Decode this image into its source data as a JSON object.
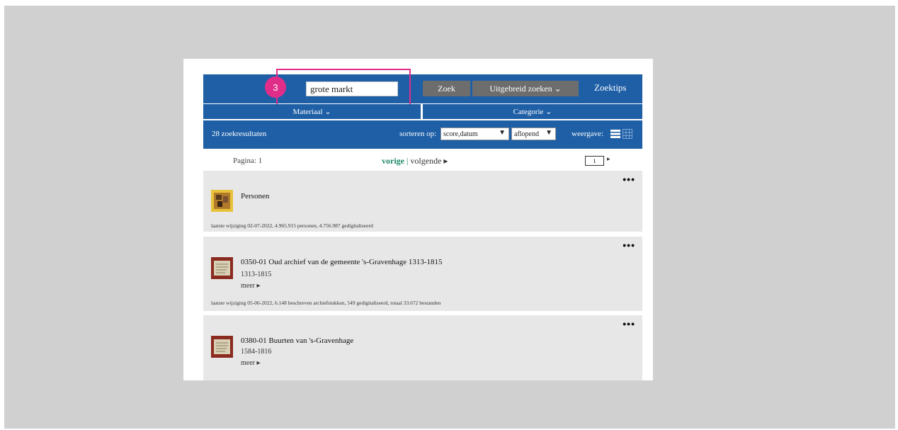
{
  "search": {
    "value": "grote markt",
    "zoek_label": "Zoek",
    "uitgebreid_label": "Uitgebreid zoeken ⌄",
    "zoektips_label": "Zoektips",
    "step_badge": "3",
    "highlight_color": "#e12d8a"
  },
  "filters": {
    "materiaal": "Materiaal ⌄",
    "categorie": "Categorie ⌄"
  },
  "results": {
    "count_label": "28 zoekresultaten",
    "sort_label": "sorteren op:",
    "sort_field": "score,datum",
    "sort_order": "aflopend",
    "view_label": "weergave:"
  },
  "pagination": {
    "pagina_label": "Pagina: 1",
    "prev_label": "vorige",
    "separator": "|",
    "next_label": "volgende ▸",
    "page_input": "1",
    "arrow": "▸"
  },
  "cards": [
    {
      "title": "Personen",
      "meta": "laatste wijziging 02-07-2022, 4.965.915 personen, 4.756.987 gedigitaliseerd",
      "more": "•••"
    },
    {
      "title": "0350-01 Oud archief van de gemeente 's-Gravenhage 1313-1815",
      "sub": "1313-1815",
      "meer": "meer ▸",
      "meta": "laatste wijziging 05-06-2022, 6.148 beschreven archiefstukken, 549 gedigitaliseerd, totaal 33.672 bestanden",
      "more": "•••"
    },
    {
      "title": "0380-01 Buurten van 's-Gravenhage",
      "sub": "1584-1816",
      "meer": "meer ▸",
      "more": "•••"
    }
  ],
  "colors": {
    "brand_blue": "#1e5fa6",
    "button_gray": "#6d6d6d",
    "link_green": "#1f8a6b",
    "card_bg": "#e7e7e7"
  }
}
